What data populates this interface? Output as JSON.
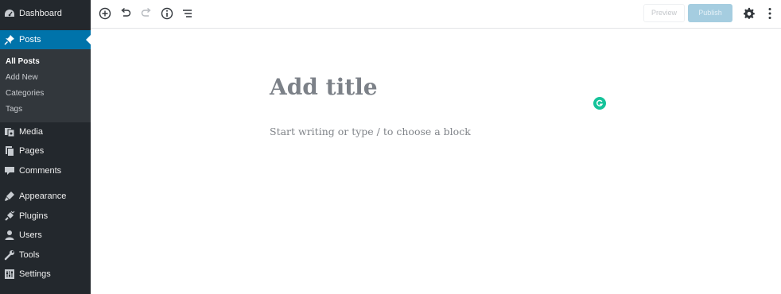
{
  "sidebar": {
    "items": [
      {
        "label": "Dashboard",
        "icon": "dashboard-icon"
      },
      {
        "label": "Posts",
        "icon": "pin-icon",
        "active": true
      },
      {
        "label": "Media",
        "icon": "media-icon"
      },
      {
        "label": "Pages",
        "icon": "pages-icon"
      },
      {
        "label": "Comments",
        "icon": "comments-icon"
      },
      {
        "label": "Appearance",
        "icon": "appearance-icon"
      },
      {
        "label": "Plugins",
        "icon": "plugins-icon"
      },
      {
        "label": "Users",
        "icon": "users-icon"
      },
      {
        "label": "Tools",
        "icon": "tools-icon"
      },
      {
        "label": "Settings",
        "icon": "settings-icon"
      }
    ],
    "submenu": [
      {
        "label": "All Posts",
        "current": true
      },
      {
        "label": "Add New"
      },
      {
        "label": "Categories"
      },
      {
        "label": "Tags"
      }
    ]
  },
  "toolbar": {
    "icons": [
      "add-block-icon",
      "undo-icon",
      "redo-icon",
      "info-icon",
      "outline-icon"
    ],
    "preview_label": "Preview",
    "publish_label": "Publish",
    "settings_icon": "gear-icon",
    "more_icon": "more-vertical-icon"
  },
  "editor": {
    "title_placeholder": "Add title",
    "block_placeholder": "Start writing or type / to choose a block"
  },
  "colors": {
    "sidebar_bg": "#23282d",
    "submenu_bg": "#32373c",
    "accent": "#0073aa",
    "publish_disabled": "#a5cde0",
    "grammarly": "#15c39a"
  }
}
